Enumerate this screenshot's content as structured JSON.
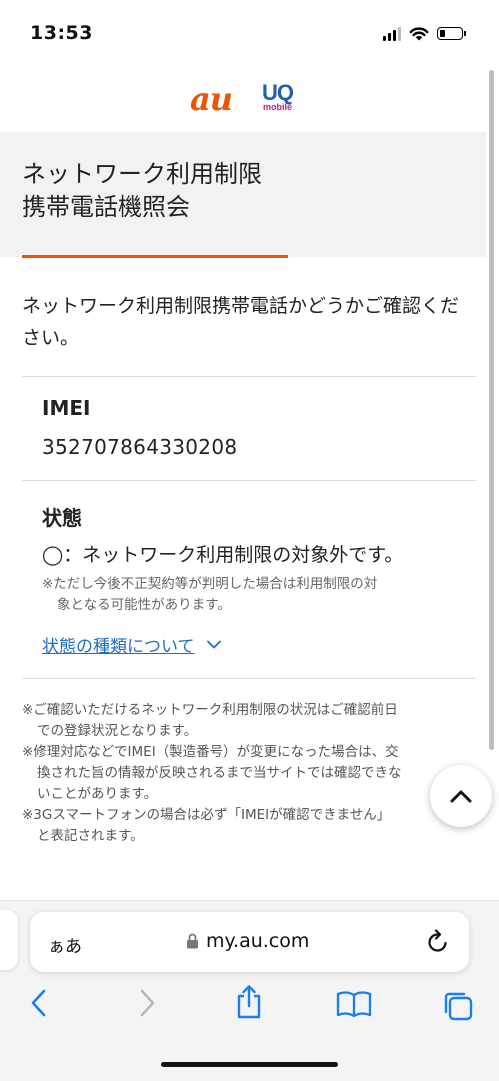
{
  "status_bar": {
    "time": "13:53",
    "signal_icon": "cellular-signal-icon",
    "wifi_icon": "wifi-icon",
    "battery_icon": "battery-low-icon"
  },
  "header": {
    "logo_au": "au",
    "logo_uq": "UQ",
    "logo_uq_sub": "mobile"
  },
  "page": {
    "title_line1": "ネットワーク利用制限",
    "title_line2": "携帯電話機照会",
    "intro": "ネットワーク利用制限携帯電話かどうかご確認ください。",
    "imei_label": "IMEI",
    "imei_value": "352707864330208",
    "state_label": "状態",
    "state_value": "◯：ネットワーク利用制限の対象外です。",
    "state_note_line1": "※ただし今後不正契約等が判明した場合は利用制限の対",
    "state_note_line2": "象となる可能性があります。",
    "state_types_link": "状態の種類について",
    "notes": [
      {
        "first": "※ご確認いただけるネットワーク利用制限の状況はご確認前日",
        "rest": "での登録状況となります。"
      },
      {
        "first": "※修理対応などでIMEI（製造番号）が変更になった場合は、交",
        "rest": "換された旨の情報が反映されるまで当サイトでは確認できな"
      },
      {
        "first": "",
        "rest": "いことがあります。"
      },
      {
        "first": "※3Gスマートフォンの場合は必ず「IMEIが確認できません」",
        "rest": "と表記されます。"
      }
    ]
  },
  "browser": {
    "aa_label": "ぁあ",
    "url": "my.au.com",
    "toolbar": [
      "back-icon",
      "forward-icon",
      "share-icon",
      "bookmarks-icon",
      "tabs-icon"
    ]
  },
  "colors": {
    "accent": "#eb5505",
    "link": "#1f6dc3",
    "uq_blue": "#1e5fb4",
    "uq_pink": "#d0188a"
  }
}
